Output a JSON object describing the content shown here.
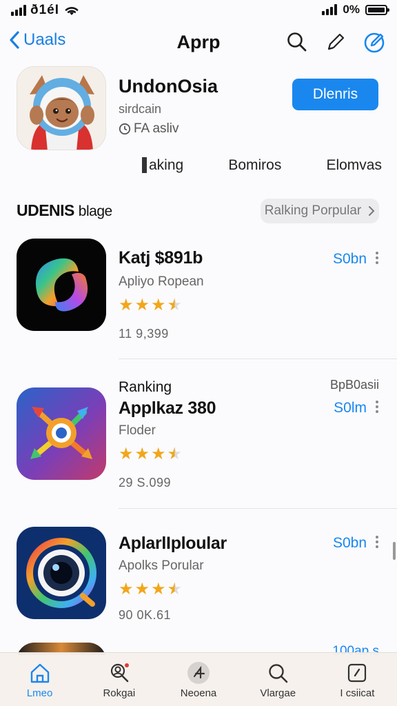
{
  "status_bar": {
    "carrier": "ð1éI",
    "battery": "0%"
  },
  "nav": {
    "back_label": "Uaals",
    "title": "Aprp"
  },
  "hero": {
    "name": "UndonOsia",
    "subtitle": "sirdcain",
    "meta": "FA asliv",
    "get_label": "Dlenris",
    "segments": [
      "aking",
      "Bomiros",
      "Elomvas"
    ]
  },
  "section": {
    "title": "UDENIS",
    "title_suffix": "blage",
    "chip_label": "Ralking Porpular"
  },
  "apps": [
    {
      "kicker": "",
      "title": "Katj $891b",
      "desc": "Apliyo Ropean",
      "stars": 3.5,
      "count": "11 9,399",
      "corner": "",
      "price": "S0bn"
    },
    {
      "kicker": "Ranking",
      "title": "Applkaz 380",
      "desc": "Floder",
      "stars": 3.5,
      "count": "29 S.099",
      "corner": "BpB0asii",
      "price": "S0lm"
    },
    {
      "kicker": "",
      "title": "AplarlIploular",
      "desc": "Apolks Porular",
      "stars": 3.5,
      "count": "90 0K.61",
      "corner": "",
      "price": "S0bn"
    },
    {
      "kicker": "",
      "title": "",
      "desc": "",
      "stars": 0,
      "count": "",
      "corner": "100ap.s",
      "price": ""
    }
  ],
  "tabs": [
    {
      "label": "Lmeo",
      "icon": "home-icon",
      "active": true
    },
    {
      "label": "Rokgai",
      "icon": "person-search-icon",
      "active": false
    },
    {
      "label": "Neoena",
      "icon": "games-icon",
      "active": false
    },
    {
      "label": "Vlargae",
      "icon": "search-icon",
      "active": false
    },
    {
      "label": "I csiicat",
      "icon": "updates-icon",
      "active": false
    }
  ],
  "colors": {
    "accent": "#1a87ee",
    "star": "#f2a61a"
  }
}
